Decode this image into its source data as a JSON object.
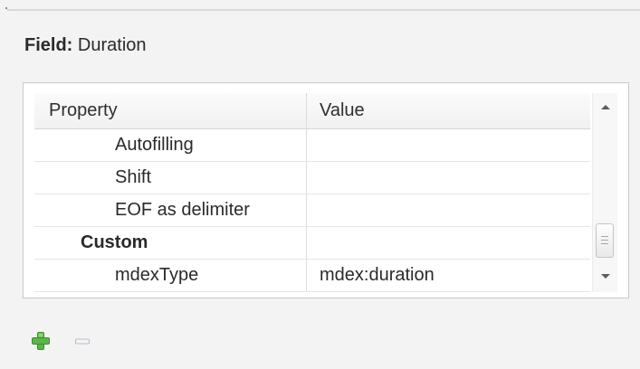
{
  "panel": {
    "title_label": "Field:",
    "title_value": "Duration"
  },
  "table": {
    "headers": {
      "property": "Property",
      "value": "Value"
    },
    "rows": [
      {
        "property": "Autofilling",
        "value": "",
        "level": 2,
        "bold": false
      },
      {
        "property": "Shift",
        "value": "",
        "level": 2,
        "bold": false
      },
      {
        "property": "EOF as delimiter",
        "value": "",
        "level": 2,
        "bold": false
      },
      {
        "property": "Custom",
        "value": "",
        "level": 1,
        "bold": true
      },
      {
        "property": "mdexType",
        "value": "mdex:duration",
        "level": 2,
        "bold": false
      }
    ]
  },
  "icons": {
    "scroll_up": "chevron-up-icon",
    "scroll_down": "chevron-down-icon",
    "add": "plus-icon",
    "remove": "minus-icon"
  },
  "colors": {
    "background": "#f3f3f3",
    "table_background": "#ffffff",
    "border": "#c9c9c9",
    "grid": "#e5e5e5",
    "add_icon": "#5db54a",
    "remove_icon": "#b8bdc6"
  }
}
